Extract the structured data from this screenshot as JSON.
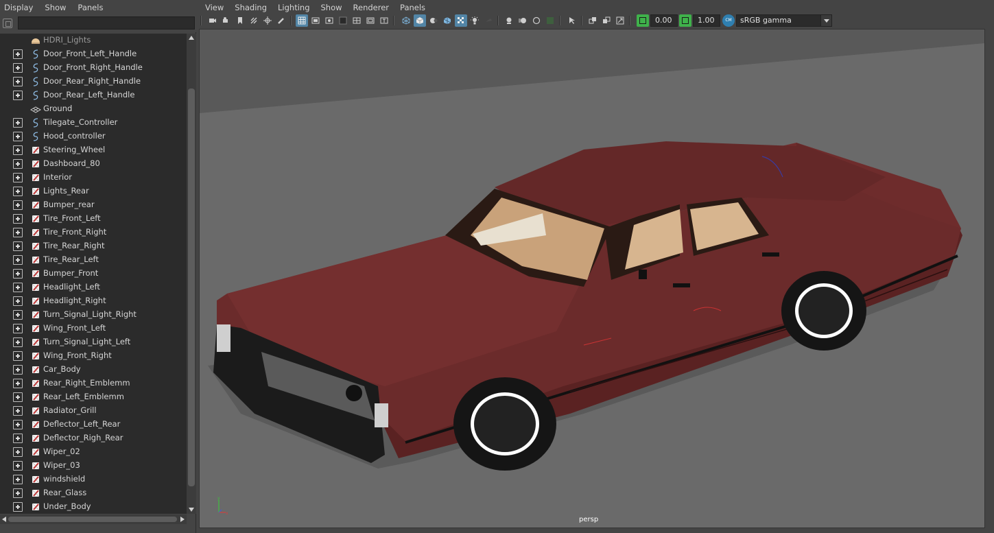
{
  "outliner": {
    "menu": [
      "Display",
      "Show",
      "Panels"
    ],
    "search_value": "",
    "items": [
      {
        "label": "HDRI_Lights",
        "icon": "dome-light-icon",
        "expandable": false,
        "dim": true
      },
      {
        "label": "Door_Front_Left_Handle",
        "icon": "nurbs-curve-icon",
        "expandable": true
      },
      {
        "label": "Door_Front_Right_Handle",
        "icon": "nurbs-curve-icon",
        "expandable": true
      },
      {
        "label": "Door_Rear_Right_Handle",
        "icon": "nurbs-curve-icon",
        "expandable": true
      },
      {
        "label": "Door_Rear_Left_Handle",
        "icon": "nurbs-curve-icon",
        "expandable": true
      },
      {
        "label": "Ground",
        "icon": "mesh-plane-icon",
        "expandable": false
      },
      {
        "label": "Tilegate_Controller",
        "icon": "nurbs-curve-icon",
        "expandable": true
      },
      {
        "label": "Hood_controller",
        "icon": "nurbs-curve-icon",
        "expandable": true
      },
      {
        "label": "Steering_Wheel",
        "icon": "mesh-icon",
        "expandable": true
      },
      {
        "label": "Dashboard_80",
        "icon": "mesh-icon",
        "expandable": true
      },
      {
        "label": "Interior",
        "icon": "mesh-icon",
        "expandable": true
      },
      {
        "label": "Lights_Rear",
        "icon": "mesh-icon",
        "expandable": true
      },
      {
        "label": "Bumper_rear",
        "icon": "mesh-icon",
        "expandable": true
      },
      {
        "label": "Tire_Front_Left",
        "icon": "mesh-icon",
        "expandable": true
      },
      {
        "label": "Tire_Front_Right",
        "icon": "mesh-icon",
        "expandable": true
      },
      {
        "label": "Tire_Rear_Right",
        "icon": "mesh-icon",
        "expandable": true
      },
      {
        "label": "Tire_Rear_Left",
        "icon": "mesh-icon",
        "expandable": true
      },
      {
        "label": "Bumper_Front",
        "icon": "mesh-icon",
        "expandable": true
      },
      {
        "label": "Headlight_Left",
        "icon": "mesh-icon",
        "expandable": true
      },
      {
        "label": "Headlight_Right",
        "icon": "mesh-icon",
        "expandable": true
      },
      {
        "label": "Turn_Signal_Light_Right",
        "icon": "mesh-icon",
        "expandable": true
      },
      {
        "label": "Wing_Front_Left",
        "icon": "mesh-icon",
        "expandable": true
      },
      {
        "label": "Turn_Signal_Light_Left",
        "icon": "mesh-icon",
        "expandable": true
      },
      {
        "label": "Wing_Front_Right",
        "icon": "mesh-icon",
        "expandable": true
      },
      {
        "label": "Car_Body",
        "icon": "mesh-icon",
        "expandable": true
      },
      {
        "label": "Rear_Right_Emblemm",
        "icon": "mesh-icon",
        "expandable": true
      },
      {
        "label": "Rear_Left_Emblemm",
        "icon": "mesh-icon",
        "expandable": true
      },
      {
        "label": "Radiator_Grill",
        "icon": "mesh-icon",
        "expandable": true
      },
      {
        "label": "Deflector_Left_Rear",
        "icon": "mesh-icon",
        "expandable": true
      },
      {
        "label": "Deflector_Righ_Rear",
        "icon": "mesh-icon",
        "expandable": true
      },
      {
        "label": "Wiper_02",
        "icon": "mesh-icon",
        "expandable": true
      },
      {
        "label": "Wiper_03",
        "icon": "mesh-icon",
        "expandable": true
      },
      {
        "label": "windshield",
        "icon": "mesh-icon",
        "expandable": true
      },
      {
        "label": "Rear_Glass",
        "icon": "mesh-icon",
        "expandable": true
      },
      {
        "label": "Under_Body",
        "icon": "mesh-icon",
        "expandable": true
      }
    ]
  },
  "viewport_panel": {
    "menu": [
      "View",
      "Shading",
      "Lighting",
      "Show",
      "Renderer",
      "Panels"
    ],
    "exposure_value": "0.00",
    "gamma_value": "1.00",
    "color_space": "sRGB gamma",
    "color_management_label": "CM",
    "camera_label": "persp",
    "axis_labels": {
      "x": "x",
      "y": "y"
    }
  },
  "colors": {
    "car_body": "#6b2b2b",
    "interior": "#d6b48e",
    "selection_blue": "#5285a6",
    "viewport_bg": "#6a6a6a"
  }
}
